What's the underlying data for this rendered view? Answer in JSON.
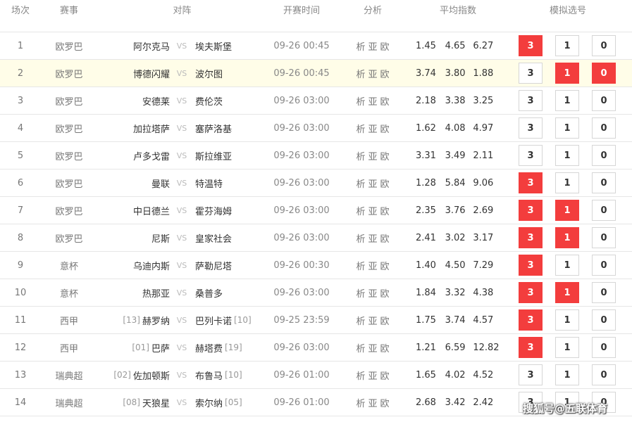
{
  "headers": {
    "no": "场次",
    "competition": "赛事",
    "match": "对阵",
    "kickoff": "开赛时间",
    "analysis": "分析",
    "avg_odds": "平均指数",
    "sim_pick": "模拟选号"
  },
  "vs_label": "VS",
  "analysis_links": [
    "析",
    "亚",
    "欧"
  ],
  "colors": {
    "selected": "#f33d3d",
    "highlight_row": "#fffde8"
  },
  "rows": [
    {
      "no": "1",
      "comp": "欧罗巴",
      "home_rank": "",
      "home": "阿尔克马",
      "away": "埃夫斯堡",
      "away_rank": "",
      "time": "09-26 00:45",
      "odds": [
        "1.45",
        "4.65",
        "6.27"
      ],
      "picks": [
        "3",
        "1",
        "0"
      ],
      "selected": [
        true,
        false,
        false
      ],
      "highlight": false
    },
    {
      "no": "2",
      "comp": "欧罗巴",
      "home_rank": "",
      "home": "博德闪耀",
      "away": "波尔图",
      "away_rank": "",
      "time": "09-26 00:45",
      "odds": [
        "3.74",
        "3.80",
        "1.88"
      ],
      "picks": [
        "3",
        "1",
        "0"
      ],
      "selected": [
        false,
        true,
        true
      ],
      "highlight": true
    },
    {
      "no": "3",
      "comp": "欧罗巴",
      "home_rank": "",
      "home": "安德莱",
      "away": "费伦茨",
      "away_rank": "",
      "time": "09-26 03:00",
      "odds": [
        "2.18",
        "3.38",
        "3.25"
      ],
      "picks": [
        "3",
        "1",
        "0"
      ],
      "selected": [
        false,
        false,
        false
      ],
      "highlight": false
    },
    {
      "no": "4",
      "comp": "欧罗巴",
      "home_rank": "",
      "home": "加拉塔萨",
      "away": "塞萨洛基",
      "away_rank": "",
      "time": "09-26 03:00",
      "odds": [
        "1.62",
        "4.08",
        "4.97"
      ],
      "picks": [
        "3",
        "1",
        "0"
      ],
      "selected": [
        false,
        false,
        false
      ],
      "highlight": false
    },
    {
      "no": "5",
      "comp": "欧罗巴",
      "home_rank": "",
      "home": "卢多戈雷",
      "away": "斯拉维亚",
      "away_rank": "",
      "time": "09-26 03:00",
      "odds": [
        "3.31",
        "3.49",
        "2.11"
      ],
      "picks": [
        "3",
        "1",
        "0"
      ],
      "selected": [
        false,
        false,
        false
      ],
      "highlight": false
    },
    {
      "no": "6",
      "comp": "欧罗巴",
      "home_rank": "",
      "home": "曼联",
      "away": "特温特",
      "away_rank": "",
      "time": "09-26 03:00",
      "odds": [
        "1.28",
        "5.84",
        "9.06"
      ],
      "picks": [
        "3",
        "1",
        "0"
      ],
      "selected": [
        true,
        false,
        false
      ],
      "highlight": false
    },
    {
      "no": "7",
      "comp": "欧罗巴",
      "home_rank": "",
      "home": "中日德兰",
      "away": "霍芬海姆",
      "away_rank": "",
      "time": "09-26 03:00",
      "odds": [
        "2.35",
        "3.76",
        "2.69"
      ],
      "picks": [
        "3",
        "1",
        "0"
      ],
      "selected": [
        true,
        true,
        false
      ],
      "highlight": false
    },
    {
      "no": "8",
      "comp": "欧罗巴",
      "home_rank": "",
      "home": "尼斯",
      "away": "皇家社会",
      "away_rank": "",
      "time": "09-26 03:00",
      "odds": [
        "2.41",
        "3.02",
        "3.17"
      ],
      "picks": [
        "3",
        "1",
        "0"
      ],
      "selected": [
        true,
        true,
        false
      ],
      "highlight": false
    },
    {
      "no": "9",
      "comp": "意杯",
      "home_rank": "",
      "home": "乌迪内斯",
      "away": "萨勒尼塔",
      "away_rank": "",
      "time": "09-26 00:30",
      "odds": [
        "1.40",
        "4.50",
        "7.29"
      ],
      "picks": [
        "3",
        "1",
        "0"
      ],
      "selected": [
        true,
        false,
        false
      ],
      "highlight": false
    },
    {
      "no": "10",
      "comp": "意杯",
      "home_rank": "",
      "home": "热那亚",
      "away": "桑普多",
      "away_rank": "",
      "time": "09-26 03:00",
      "odds": [
        "1.84",
        "3.32",
        "4.38"
      ],
      "picks": [
        "3",
        "1",
        "0"
      ],
      "selected": [
        true,
        true,
        false
      ],
      "highlight": false
    },
    {
      "no": "11",
      "comp": "西甲",
      "home_rank": "[13]",
      "home": "赫罗纳",
      "away": "巴列卡诺",
      "away_rank": "[10]",
      "time": "09-25 23:59",
      "odds": [
        "1.75",
        "3.74",
        "4.57"
      ],
      "picks": [
        "3",
        "1",
        "0"
      ],
      "selected": [
        true,
        false,
        false
      ],
      "highlight": false
    },
    {
      "no": "12",
      "comp": "西甲",
      "home_rank": "[01]",
      "home": "巴萨",
      "away": "赫塔费",
      "away_rank": "[19]",
      "time": "09-26 03:00",
      "odds": [
        "1.21",
        "6.59",
        "12.82"
      ],
      "picks": [
        "3",
        "1",
        "0"
      ],
      "selected": [
        true,
        false,
        false
      ],
      "highlight": false
    },
    {
      "no": "13",
      "comp": "瑞典超",
      "home_rank": "[02]",
      "home": "佐加顿斯",
      "away": "布鲁马",
      "away_rank": "[10]",
      "time": "09-26 01:00",
      "odds": [
        "1.65",
        "4.02",
        "4.52"
      ],
      "picks": [
        "3",
        "1",
        "0"
      ],
      "selected": [
        false,
        false,
        false
      ],
      "highlight": false
    },
    {
      "no": "14",
      "comp": "瑞典超",
      "home_rank": "[08]",
      "home": "天狼星",
      "away": "索尔纳",
      "away_rank": "[05]",
      "time": "09-26 01:00",
      "odds": [
        "2.68",
        "3.42",
        "2.42"
      ],
      "picks": [
        "3",
        "1",
        "0"
      ],
      "selected": [
        false,
        false,
        false
      ],
      "highlight": false
    }
  ],
  "watermark": "搜狐号@五联体育"
}
